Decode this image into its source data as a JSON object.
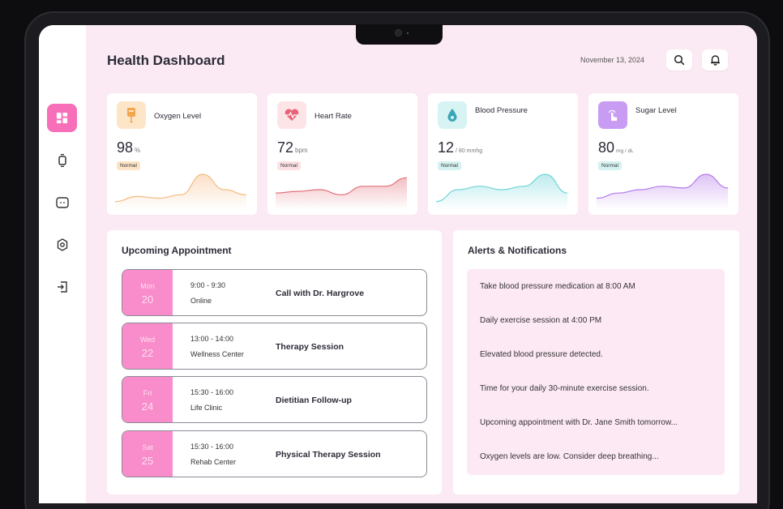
{
  "header": {
    "title": "Health Dashboard",
    "date": "November 13, 2024"
  },
  "sidebar": {
    "items": [
      {
        "name": "dashboard-icon",
        "active": true
      },
      {
        "name": "watch-icon"
      },
      {
        "name": "chat-icon"
      },
      {
        "name": "gear-icon"
      },
      {
        "name": "logout-icon"
      }
    ]
  },
  "cards": [
    {
      "title": "Oxygen Level",
      "value": "98",
      "unit": "%",
      "status": "Normal",
      "icon": "oxygen-drip-icon",
      "color": "#f5b980",
      "level": [
        0.15,
        0.3,
        0.25,
        0.35,
        0.95,
        0.5,
        0.35
      ]
    },
    {
      "title": "Heart Rate",
      "value": "72",
      "unit": "bpm",
      "status": "Normal",
      "icon": "heart-rate-icon",
      "color": "#e3717b",
      "level": [
        0.4,
        0.45,
        0.5,
        0.35,
        0.6,
        0.6,
        0.85
      ]
    },
    {
      "title": "Blood Pressure",
      "value": "12",
      "unit": "/ 80 mmhg",
      "status": "Normal",
      "icon": "blood-drop-icon",
      "color": "#6ed4d8",
      "level": [
        0.15,
        0.5,
        0.6,
        0.5,
        0.6,
        0.95,
        0.4
      ]
    },
    {
      "title": "Sugar Level",
      "value": "80",
      "unit": "mg / dL",
      "status": "Normal",
      "icon": "finger-tap-icon",
      "color": "#b47bea",
      "level": [
        0.25,
        0.4,
        0.5,
        0.6,
        0.55,
        0.95,
        0.55
      ]
    }
  ],
  "appointments": {
    "title": "Upcoming Appointment",
    "items": [
      {
        "dow": "Mon",
        "day": "20",
        "time": "9:00 - 9:30",
        "location": "Online",
        "title": "Call with Dr. Hargrove"
      },
      {
        "dow": "Wed",
        "day": "22",
        "time": "13:00 - 14:00",
        "location": "Wellness Center",
        "title": "Therapy Session"
      },
      {
        "dow": "Fri",
        "day": "24",
        "time": "15:30 - 16:00",
        "location": "Life Clinic",
        "title": "Dietitian Follow-up"
      },
      {
        "dow": "Sat",
        "day": "25",
        "time": "15:30 - 16:00",
        "location": "Rehab Center",
        "title": "Physical Therapy Session"
      }
    ]
  },
  "alerts": {
    "title": "Alerts & Notifications",
    "items": [
      "Take blood pressure medication at 8:00 AM",
      "Daily exercise session at 4:00 PM",
      "Elevated blood pressure detected.",
      "Time for your daily 30-minute exercise session.",
      "Upcoming appointment with Dr. Jane Smith tomorrow...",
      "Oxygen levels are low. Consider deep breathing..."
    ]
  }
}
